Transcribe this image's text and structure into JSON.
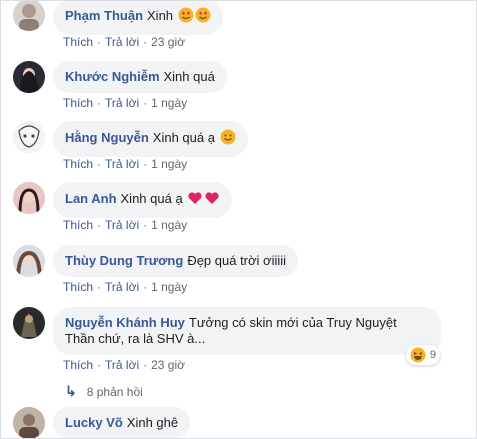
{
  "labels": {
    "like": "Thích",
    "reply": "Trả lời",
    "dot": "·"
  },
  "comments": [
    {
      "author": "Phạm Thuận",
      "text": "Xinh",
      "time": "23 giờ"
    },
    {
      "author": "Khước Nghiễm",
      "text": "Xinh quá",
      "time": "1 ngày"
    },
    {
      "author": "Hằng Nguyễn",
      "text": "Xinh quá ạ",
      "time": "1 ngày"
    },
    {
      "author": "Lan Anh",
      "text": "Xinh quá ạ",
      "time": "1 ngày"
    },
    {
      "author": "Thùy Dung Trương",
      "text": "Đẹp quá trời ơiiiii",
      "time": "1 ngày"
    },
    {
      "author": "Nguyễn Khánh Huy",
      "text": "Tưởng có skin mới của Truy Nguyệt Thần chứ, ra là SHV à...",
      "time": "23 giờ",
      "reaction_count": "9",
      "replies": "8 phản hồi"
    },
    {
      "author": "Lucky Võ",
      "text": "Xinh ghê"
    }
  ],
  "colors": {
    "link": "#385898",
    "bubble": "#f2f3f5",
    "meta": "#606770",
    "heart": "#e0245e",
    "emoji": "#f7b125"
  }
}
